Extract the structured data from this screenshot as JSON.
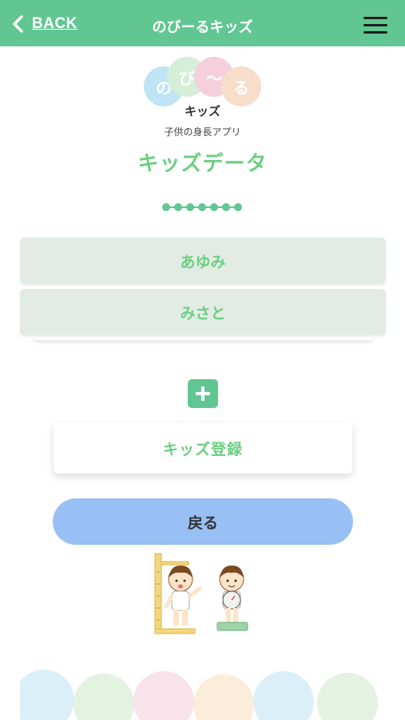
{
  "header": {
    "back_label": "BACK",
    "title": "のびーるキッズ",
    "menu_icon": "hamburger-menu-icon",
    "background_color": "#62c692"
  },
  "logo": {
    "bubbles": [
      "の",
      "び",
      "〜",
      "る"
    ],
    "name": "キッズ",
    "subtitle": "子供の身長アプリ"
  },
  "page": {
    "title": "キッズデータ",
    "accent_color": "#6bcf82"
  },
  "kids": [
    {
      "name": "あゆみ"
    },
    {
      "name": "みさと"
    }
  ],
  "actions": {
    "add_icon": "plus-icon",
    "register_label": "キッズ登録",
    "back_label": "戻る",
    "back_color": "#98c0f5"
  }
}
